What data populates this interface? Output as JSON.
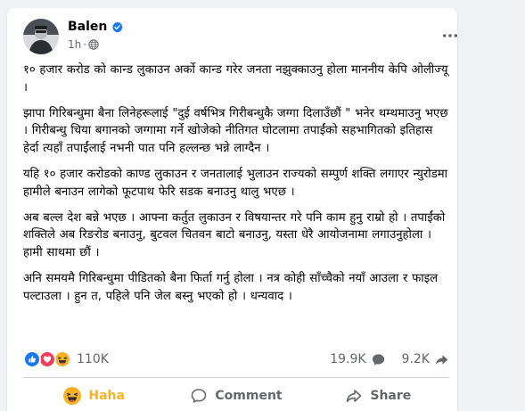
{
  "post": {
    "author": "Balen",
    "time": "1h",
    "separator": "·",
    "paragraphs": [
      "१० हजार करोड को कान्ड लुकाउन अर्को कान्ड गरेर जनता नझुक्काउनु होला माननीय केपि ओलीज्यू ।",
      "झापा गिरिबन्धुमा बैना लिनेहरूलाई \"दुई वर्षभित्र गिरीबन्धुकै जग्गा दिलाउँछौं \" भनेर थम्थमाउनु भएछ    । गिरीबन्धु चिया बगानको जग्गामा गर्ने खोजेको नीतिगत घोटलामा तपाईंको सहभागितको इतिहास हेर्दा त्यहाँ तपाईंलाई नभनी पात पनि हल्लन्छ भन्ने लाग्दैन ।",
      "यहि  १०  हजार करोडको काण्ड लुकाउन र जनतालाई भुलाउन राज्यको सम्पुर्ण शक्ति लगाएर न्युरोडमा हामीले बनाउन लागेको फूटपाथ फेरि सडक बनाउनु थालु भएछ ।",
      "अब बल्ल देश बन्ने भएछ । आफ्ना कर्तुत लुकाउन र विषयान्तर गरे पनि काम हुनु राम्रो हो । तपाईंको शक्तिले अब रिङरोड बनाउनु, बुटवल चितवन बाटो बनाउनु, यस्ता धेरै आयोजनामा लगाउनुहोला । हामी साथमा छौं ।",
      "अनि समयमै गिरिबन्धुमा पीडितको बैना फिर्ता गर्नु होला । नत्र कोही साँच्चैको नयाँ आउला र फाइल पल्टाउला । हुन त, पहिले पनि जेल बस्नु भएको हो । धन्यवाद ।"
    ]
  },
  "stats": {
    "reactions_count": "110K",
    "comments_count": "19.9K",
    "shares_count": "9.2K",
    "reaction_icons": [
      "like-icon",
      "love-icon",
      "haha-icon"
    ]
  },
  "actions": {
    "haha_label": "Haha",
    "comment_label": "Comment",
    "share_label": "Share"
  },
  "colors": {
    "like": "#1877f2",
    "love": "#f33e58",
    "haha": "#f7b125",
    "secondary_text": "#65676b"
  }
}
